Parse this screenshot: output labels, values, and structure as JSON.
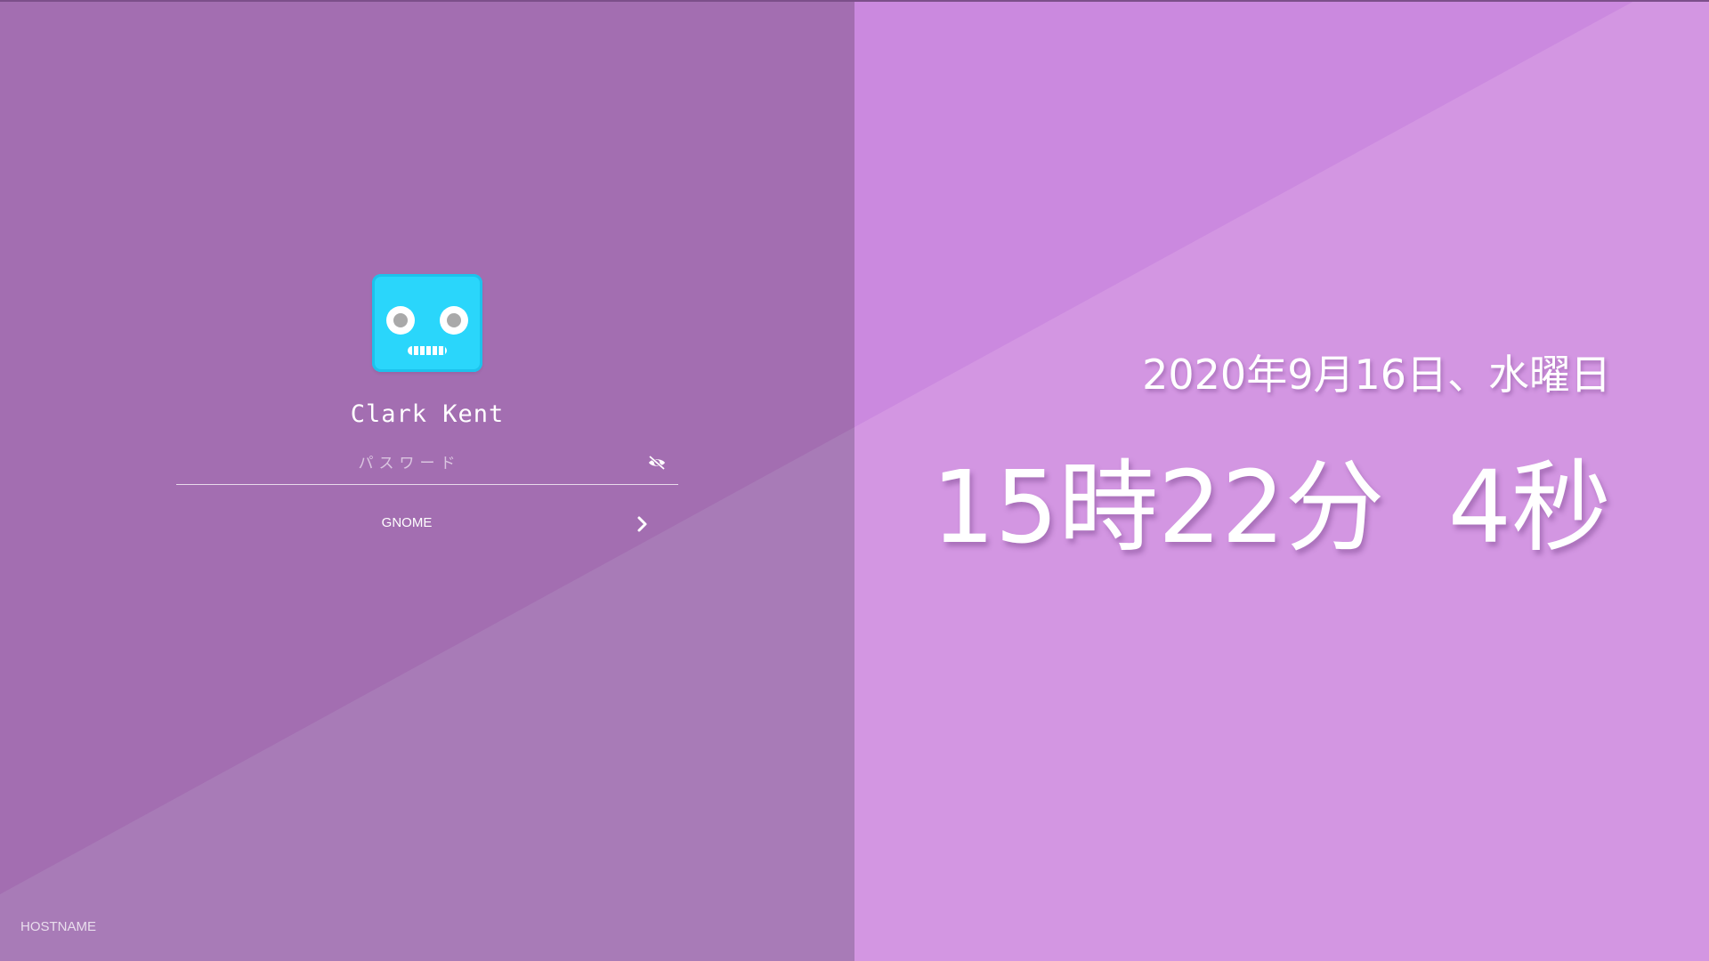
{
  "login": {
    "username": "Clark Kent",
    "password_placeholder": "パスワード",
    "session": "GNOME",
    "hostname": "HOSTNAME"
  },
  "clock": {
    "date": "2020年9月16日、水曜日",
    "time": "15時22分  4秒"
  },
  "icons": {
    "avatar": "robot-avatar-icon",
    "password_visibility": "eye-off-icon",
    "session_next": "chevron-right-icon"
  },
  "colors": {
    "left_bg": "#a36eb1",
    "right_bg": "#cb89df",
    "avatar": "#2ad6fb"
  }
}
